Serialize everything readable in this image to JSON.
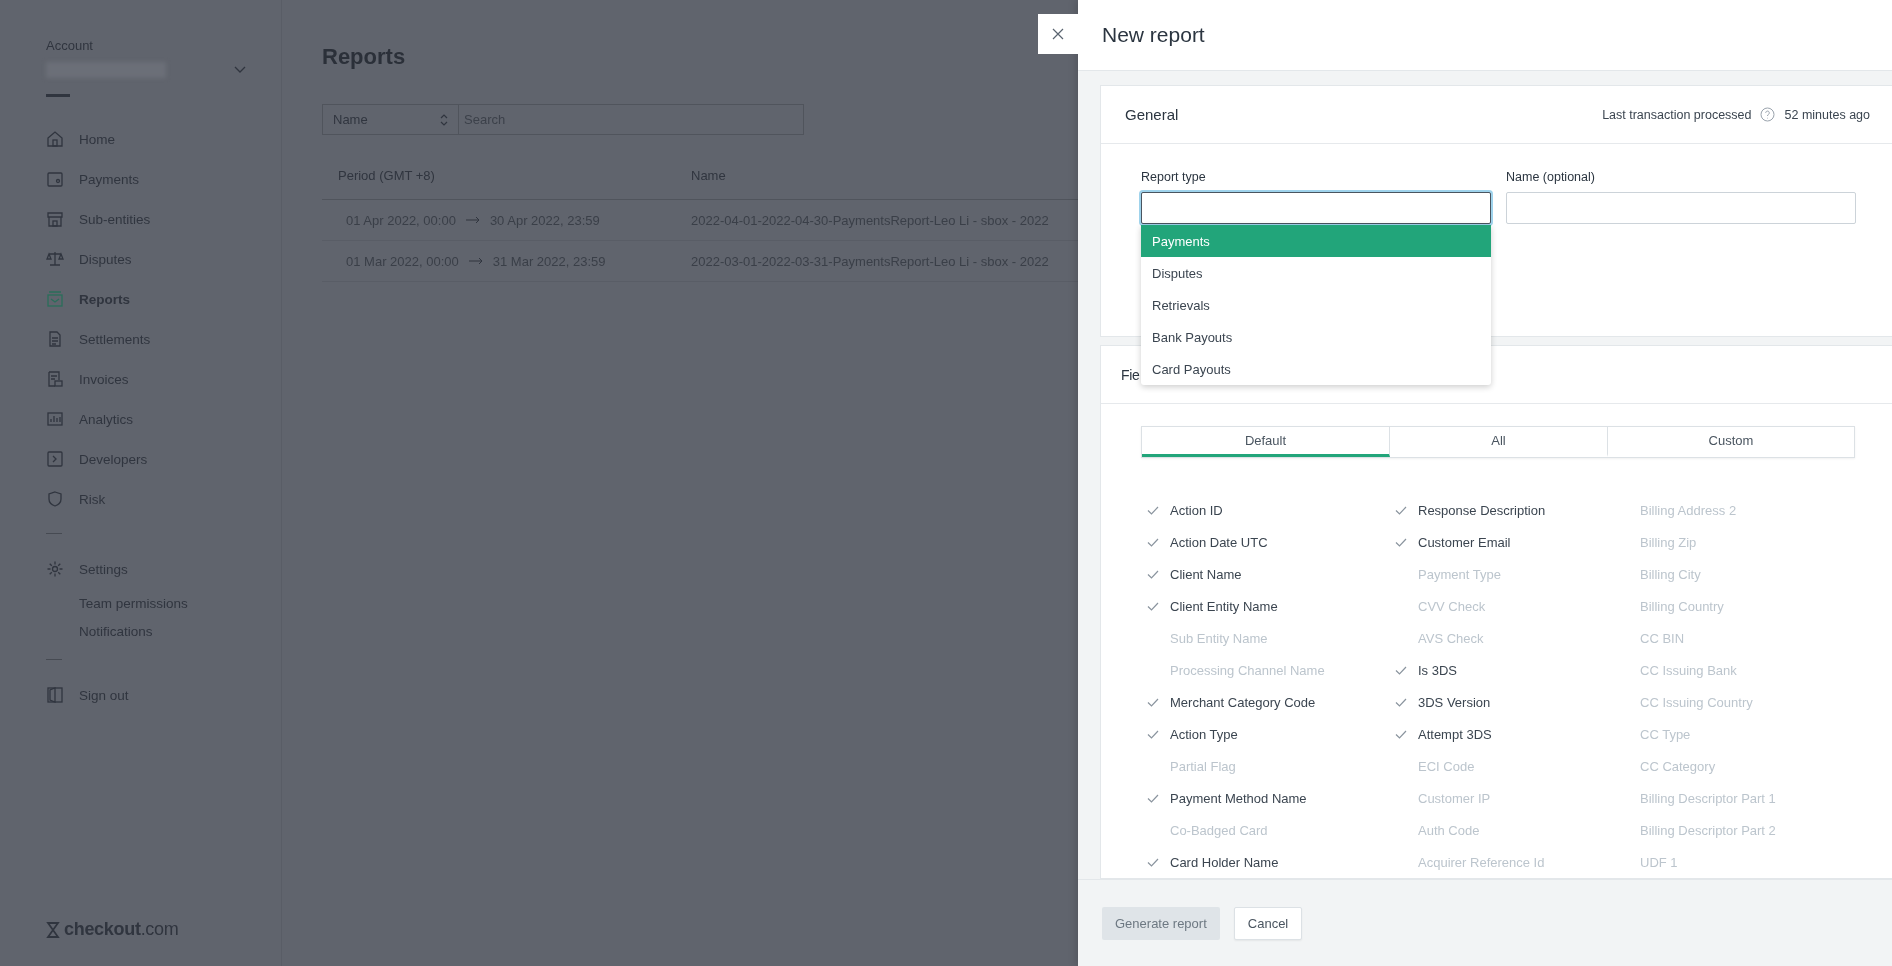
{
  "sidebar": {
    "account_label": "Account",
    "groups": [
      [
        {
          "label": "Home",
          "kind": "home",
          "selected": false
        },
        {
          "label": "Payments",
          "kind": "wallet",
          "selected": false
        },
        {
          "label": "Sub-entities",
          "kind": "store",
          "selected": false
        },
        {
          "label": "Disputes",
          "kind": "scales",
          "selected": false
        },
        {
          "label": "Reports",
          "kind": "report",
          "selected": true
        },
        {
          "label": "Settlements",
          "kind": "document",
          "selected": false
        },
        {
          "label": "Invoices",
          "kind": "invoice",
          "selected": false
        },
        {
          "label": "Analytics",
          "kind": "chart",
          "selected": false
        },
        {
          "label": "Developers",
          "kind": "code",
          "selected": false
        },
        {
          "label": "Risk",
          "kind": "shield",
          "selected": false
        }
      ],
      [
        {
          "label": "Settings",
          "kind": "gear",
          "selected": false,
          "children": [
            {
              "label": "Team permissions"
            },
            {
              "label": "Notifications"
            }
          ]
        }
      ],
      [
        {
          "label": "Sign out",
          "kind": "door",
          "selected": false
        }
      ]
    ],
    "logo": "**checkout**.com"
  },
  "page": {
    "title": "Reports",
    "filter": {
      "select": "Name",
      "placeholder": "Search"
    },
    "table": {
      "columns": [
        "Period (GMT +8)",
        "Name"
      ],
      "rows": [
        {
          "start": "01 Apr 2022, 00:00",
          "end": "30 Apr 2022, 23:59",
          "name": "2022-04-01-2022-04-30-PaymentsReport-Leo Li - sbox - 2022"
        },
        {
          "start": "01 Mar 2022, 00:00",
          "end": "31 Mar 2022, 23:59",
          "name": "2022-03-01-2022-03-31-PaymentsReport-Leo Li - sbox - 2022"
        }
      ]
    }
  },
  "panel": {
    "title": "New report",
    "general": {
      "title": "General",
      "last_label": "Last transaction processed",
      "last_value": "52 minutes ago",
      "fields": [
        {
          "label": "Report type",
          "focused": true
        },
        {
          "label": "Name (optional)",
          "focused": false
        }
      ],
      "dropdown": [
        {
          "label": "Payments",
          "selected": true
        },
        {
          "label": "Disputes",
          "selected": false
        },
        {
          "label": "Retrievals",
          "selected": false
        },
        {
          "label": "Bank Payouts",
          "selected": false
        },
        {
          "label": "Card Payouts",
          "selected": false
        }
      ]
    },
    "fields_section": {
      "title": "Fie",
      "tabs": [
        {
          "label": "Default",
          "selected": true
        },
        {
          "label": "All",
          "selected": false
        },
        {
          "label": "Custom",
          "selected": false
        }
      ],
      "columns": [
        [
          {
            "label": "Action ID",
            "checked": true
          },
          {
            "label": "Action Date UTC",
            "checked": true
          },
          {
            "label": "Client Name",
            "checked": true
          },
          {
            "label": "Client Entity Name",
            "checked": true
          },
          {
            "label": "Sub Entity Name",
            "checked": false
          },
          {
            "label": "Processing Channel Name",
            "checked": false
          },
          {
            "label": "Merchant Category Code",
            "checked": true
          },
          {
            "label": "Action Type",
            "checked": true
          },
          {
            "label": "Partial Flag",
            "checked": false
          },
          {
            "label": "Payment Method Name",
            "checked": true
          },
          {
            "label": "Co-Badged Card",
            "checked": false
          },
          {
            "label": "Card Holder Name",
            "checked": true
          }
        ],
        [
          {
            "label": "Response Description",
            "checked": true
          },
          {
            "label": "Customer Email",
            "checked": true
          },
          {
            "label": "Payment Type",
            "checked": false
          },
          {
            "label": "CVV Check",
            "checked": false
          },
          {
            "label": "AVS Check",
            "checked": false
          },
          {
            "label": "Is 3DS",
            "checked": true
          },
          {
            "label": "3DS Version",
            "checked": true
          },
          {
            "label": "Attempt 3DS",
            "checked": true
          },
          {
            "label": "ECI Code",
            "checked": false
          },
          {
            "label": "Customer IP",
            "checked": false
          },
          {
            "label": "Auth Code",
            "checked": false
          },
          {
            "label": "Acquirer Reference Id",
            "checked": false
          }
        ],
        [
          {
            "label": "Billing Address 2",
            "checked": false
          },
          {
            "label": "Billing Zip",
            "checked": false
          },
          {
            "label": "Billing City",
            "checked": false
          },
          {
            "label": "Billing Country",
            "checked": false
          },
          {
            "label": "CC BIN",
            "checked": false
          },
          {
            "label": "CC Issuing Bank",
            "checked": false
          },
          {
            "label": "CC Issuing Country",
            "checked": false
          },
          {
            "label": "CC Type",
            "checked": false
          },
          {
            "label": "CC Category",
            "checked": false
          },
          {
            "label": "Billing Descriptor Part 1",
            "checked": false
          },
          {
            "label": "Billing Descriptor Part 2",
            "checked": false
          },
          {
            "label": "UDF 1",
            "checked": false
          }
        ]
      ]
    },
    "buttons": [
      {
        "label": "Generate report",
        "kind": "primary",
        "disabled": true
      },
      {
        "label": "Cancel",
        "kind": "secondary",
        "disabled": false
      }
    ]
  }
}
